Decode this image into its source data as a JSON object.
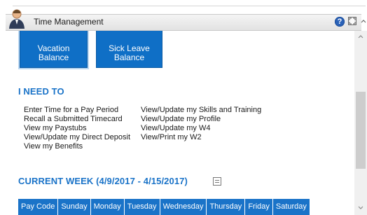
{
  "window": {
    "title": "Time Management",
    "help_glyph": "?",
    "icons": [
      "person-icon",
      "help-icon",
      "expand-icon",
      "chevron-up-icon"
    ]
  },
  "tiles": [
    {
      "line1": "Vacation",
      "line2": "Balance"
    },
    {
      "line1": "Sick Leave",
      "line2": "Balance"
    }
  ],
  "i_need_to": {
    "title": "I NEED TO",
    "col1": [
      "Enter Time for a Pay Period",
      "Recall a Submitted Timecard",
      "View my Paystubs",
      "View/Update my Direct Deposit",
      "View my Benefits"
    ],
    "col2": [
      "View/Update my Skills and Training",
      "View/Update my Profile",
      "View/Update my W4",
      "View/Print my W2"
    ]
  },
  "current_week": {
    "title": "CURRENT WEEK (4/9/2017 - 4/15/2017)",
    "columns": [
      "Pay Code",
      "Sunday",
      "Monday",
      "Tuesday",
      "Wednesday",
      "Thursday",
      "Friday",
      "Saturday"
    ]
  },
  "colors": {
    "accent": "#1a73c8",
    "tile": "#0f6fc6"
  }
}
